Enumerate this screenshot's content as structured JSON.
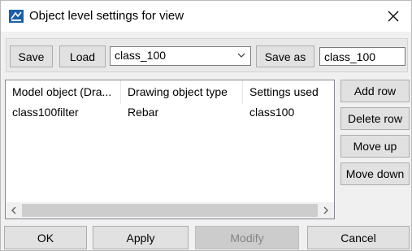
{
  "window": {
    "title": "Object level settings for view"
  },
  "icons": {
    "app": "drawing-app-icon",
    "close": "close-icon",
    "combo_arrow": "chevron-down-icon",
    "scroll_left": "chevron-left-icon",
    "scroll_right": "chevron-right-icon"
  },
  "toolbar": {
    "save_label": "Save",
    "load_label": "Load",
    "settings_combo_value": "class_100",
    "save_as_label": "Save as",
    "save_as_value": "class_100"
  },
  "grid": {
    "columns": [
      "Model object (Dra...",
      "Drawing object type",
      "Settings used"
    ],
    "rows": [
      [
        "class100filter",
        "Rebar",
        "class100"
      ]
    ]
  },
  "side_buttons": {
    "add_row": "Add row",
    "delete_row": "Delete row",
    "move_up": "Move up",
    "move_down": "Move down"
  },
  "footer": {
    "ok": "OK",
    "apply": "Apply",
    "modify": "Modify",
    "cancel": "Cancel"
  },
  "colors": {
    "accent": "#1a5fa8",
    "button_bg": "#e1e1e1",
    "disabled_bg": "#cccccc"
  }
}
